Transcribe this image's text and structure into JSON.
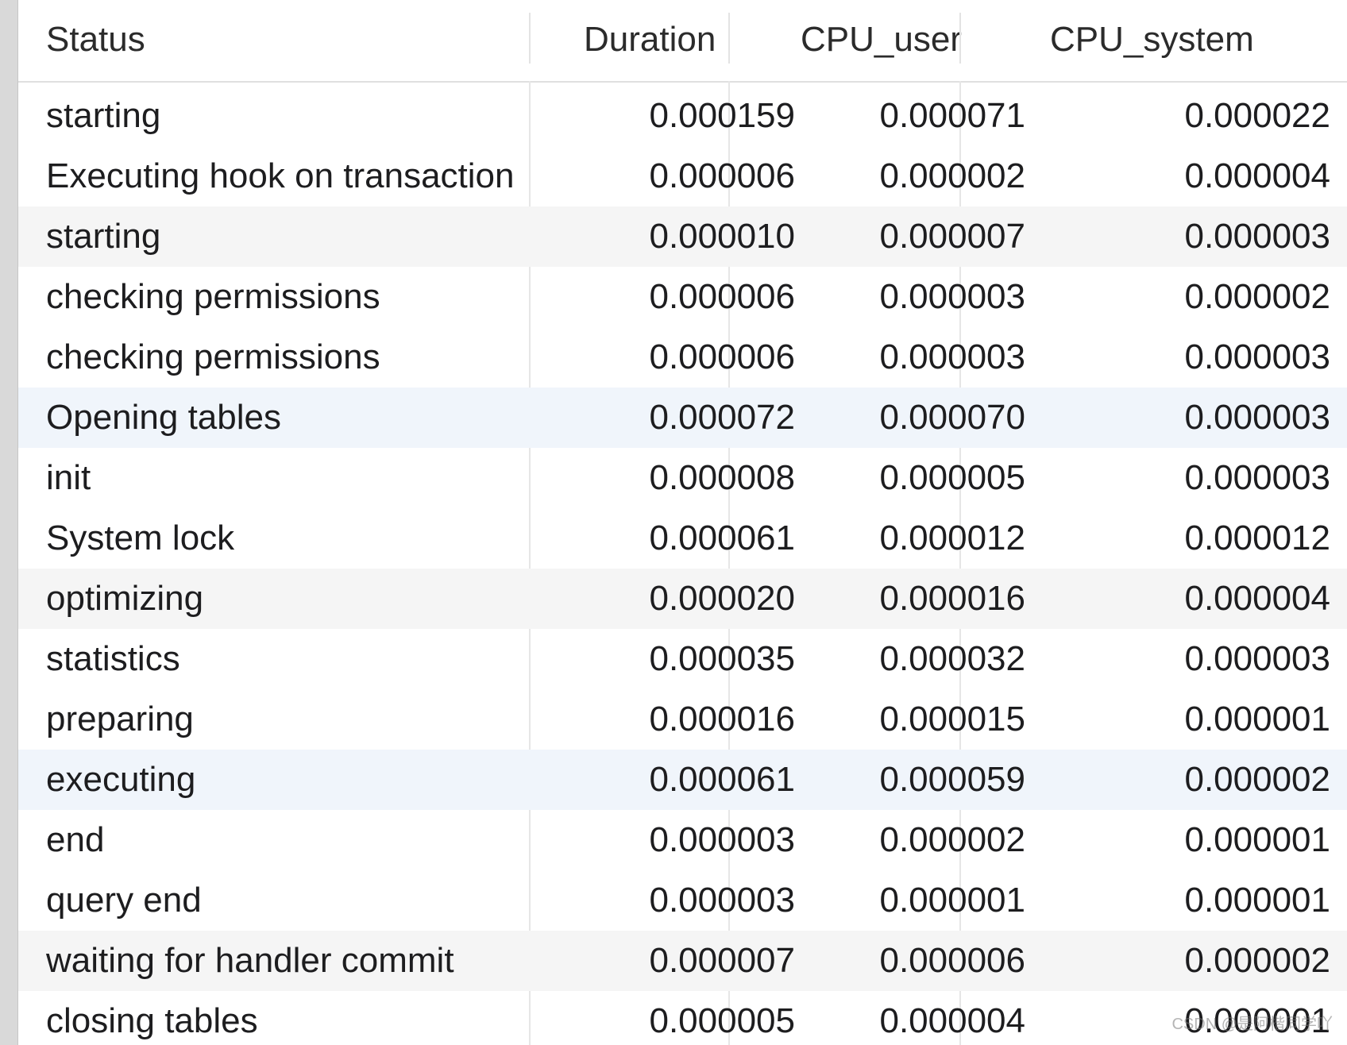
{
  "table": {
    "columns": [
      "Status",
      "Duration",
      "CPU_user",
      "CPU_system"
    ],
    "rows": [
      {
        "status": "starting",
        "duration": "0.000159",
        "cpu_user": "0.000071",
        "cpu_system": "0.000022"
      },
      {
        "status": "Executing hook on transaction",
        "duration": "0.000006",
        "cpu_user": "0.000002",
        "cpu_system": "0.000004"
      },
      {
        "status": "starting",
        "duration": "0.000010",
        "cpu_user": "0.000007",
        "cpu_system": "0.000003"
      },
      {
        "status": "checking permissions",
        "duration": "0.000006",
        "cpu_user": "0.000003",
        "cpu_system": "0.000002"
      },
      {
        "status": "checking permissions",
        "duration": "0.000006",
        "cpu_user": "0.000003",
        "cpu_system": "0.000003"
      },
      {
        "status": "Opening tables",
        "duration": "0.000072",
        "cpu_user": "0.000070",
        "cpu_system": "0.000003"
      },
      {
        "status": "init",
        "duration": "0.000008",
        "cpu_user": "0.000005",
        "cpu_system": "0.000003"
      },
      {
        "status": "System lock",
        "duration": "0.000061",
        "cpu_user": "0.000012",
        "cpu_system": "0.000012"
      },
      {
        "status": "optimizing",
        "duration": "0.000020",
        "cpu_user": "0.000016",
        "cpu_system": "0.000004"
      },
      {
        "status": "statistics",
        "duration": "0.000035",
        "cpu_user": "0.000032",
        "cpu_system": "0.000003"
      },
      {
        "status": "preparing",
        "duration": "0.000016",
        "cpu_user": "0.000015",
        "cpu_system": "0.000001"
      },
      {
        "status": "executing",
        "duration": "0.000061",
        "cpu_user": "0.000059",
        "cpu_system": "0.000002"
      },
      {
        "status": "end",
        "duration": "0.000003",
        "cpu_user": "0.000002",
        "cpu_system": "0.000001"
      },
      {
        "status": "query end",
        "duration": "0.000003",
        "cpu_user": "0.000001",
        "cpu_system": "0.000001"
      },
      {
        "status": "waiting for handler commit",
        "duration": "0.000007",
        "cpu_user": "0.000006",
        "cpu_system": "0.000002"
      },
      {
        "status": "closing tables",
        "duration": "0.000005",
        "cpu_user": "0.000004",
        "cpu_system": "0.000001"
      }
    ]
  },
  "watermark": "CSDN @是阿楷同学吖",
  "colors": {
    "row_alt": "#f5f5f5",
    "row_selected": "#f0f5fb",
    "text": "#1d1d1f",
    "separator": "#e6e6e6"
  }
}
